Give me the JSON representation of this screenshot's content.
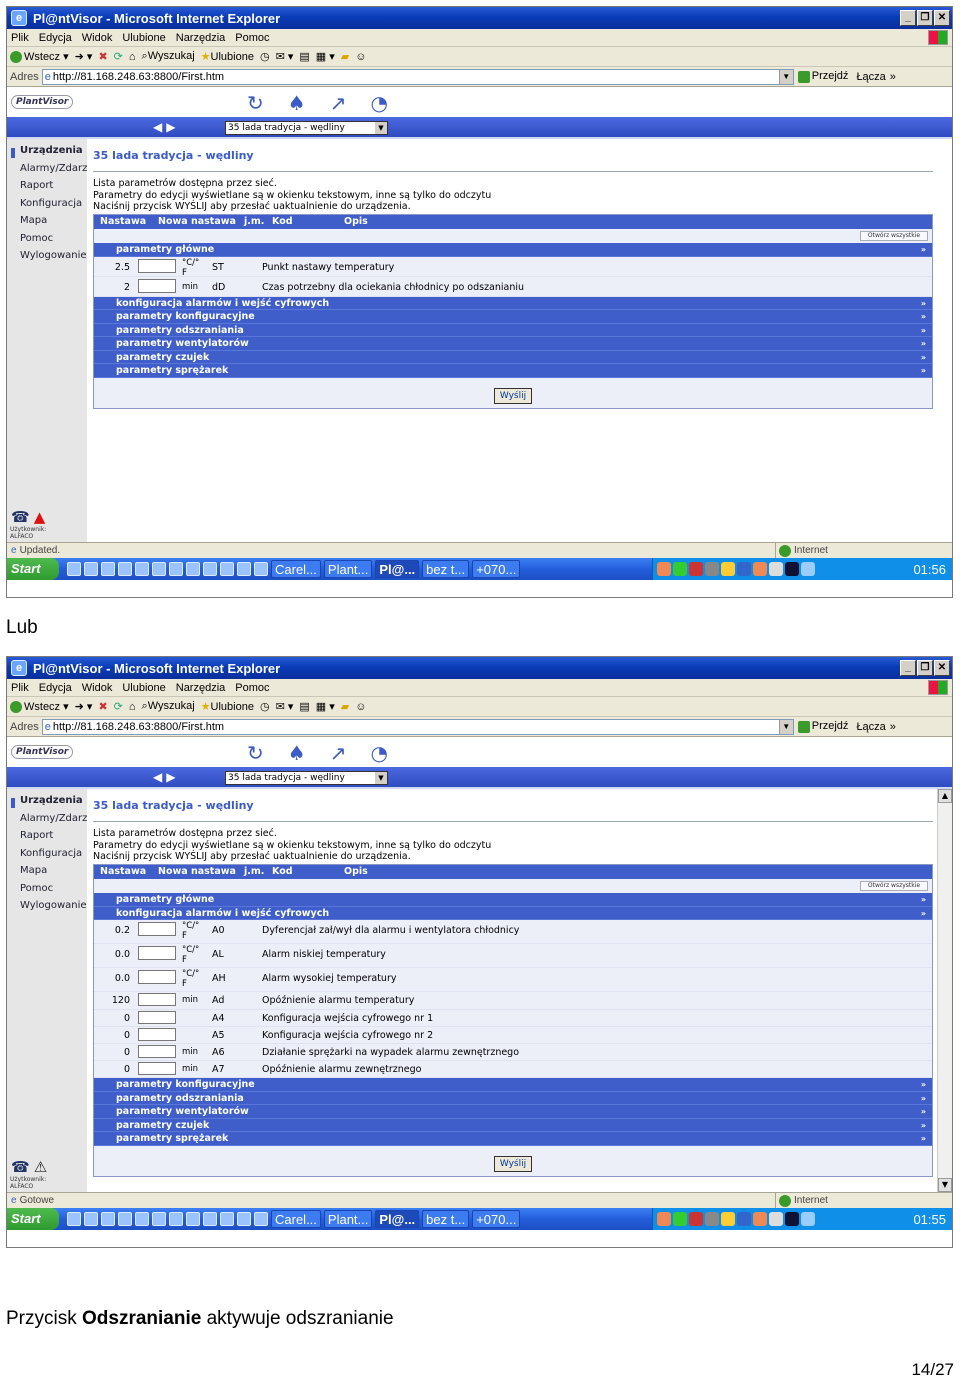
{
  "window_title": "Pl@ntVisor - Microsoft Internet Explorer",
  "menu": [
    "Plik",
    "Edycja",
    "Widok",
    "Ulubione",
    "Narzędzia",
    "Pomoc"
  ],
  "toolbar": {
    "back": "Wstecz",
    "search": "Wyszukaj",
    "favorites": "Ulubione"
  },
  "address": {
    "label": "Adres",
    "url": "http://81.168.248.63:8800/First.htm",
    "go": "Przejdź",
    "links": "Łącza"
  },
  "app": {
    "logo": "PlantVisor",
    "device_select": "35 lada tradycja - wędliny"
  },
  "sidebar": {
    "items": [
      "Urządzenia",
      "Alarmy/Zdarzenia",
      "Raport",
      "Konfiguracja",
      "Mapa",
      "Pomoc",
      "Wylogowanie"
    ],
    "user": "Użytkownik: ALFACO"
  },
  "page": {
    "title": "35 lada tradycja - wędliny",
    "desc1": "Lista parametrów dostępna przez sieć.",
    "desc2": "Parametry do edycji wyświetlane są w okienku tekstowym, inne są tylko do odczytu",
    "desc3": "Naciśnij przycisk WYŚLIJ aby przesłać uaktualnienie do urządzenia."
  },
  "grid": {
    "col_value": "Nastawa",
    "col_new": "Nowa nastawa",
    "col_unit": "j.m.",
    "col_code": "Kod",
    "col_desc": "Opis",
    "open_all": "Otwórz wszystkie",
    "send": "Wyślij"
  },
  "sections": {
    "main": "parametry główne",
    "alarm": "konfiguracja alarmów i wejść cyfrowych",
    "config": "parametry konfiguracyjne",
    "defrost": "parametry odszraniania",
    "fans": "parametry wentylatorów",
    "probes": "parametry czujek",
    "comp": "parametry sprężarek"
  },
  "shot1": {
    "params": [
      {
        "val": "2.5",
        "unit": "°C/° F",
        "code": "ST",
        "desc": "Punkt nastawy temperatury"
      },
      {
        "val": "2",
        "unit": "min",
        "code": "dD",
        "desc": "Czas potrzebny dla ociekania chłodnicy po odszanianiu"
      }
    ],
    "status": "Updated.",
    "clock": "01:56"
  },
  "shot2": {
    "params": [
      {
        "val": "0.2",
        "unit": "°C/° F",
        "code": "A0",
        "desc": "Dyferencjał zał/wył dla alarmu i wentylatora chłodnicy"
      },
      {
        "val": "0.0",
        "unit": "°C/° F",
        "code": "AL",
        "desc": "Alarm niskiej temperatury"
      },
      {
        "val": "0.0",
        "unit": "°C/° F",
        "code": "AH",
        "desc": "Alarm wysokiej temperatury"
      },
      {
        "val": "120",
        "unit": "min",
        "code": "Ad",
        "desc": "Opóźnienie alarmu temperatury"
      },
      {
        "val": "0",
        "unit": "",
        "code": "A4",
        "desc": "Konfiguracja wejścia cyfrowego nr 1"
      },
      {
        "val": "0",
        "unit": "",
        "code": "A5",
        "desc": "Konfiguracja wejścia cyfrowego nr 2"
      },
      {
        "val": "0",
        "unit": "min",
        "code": "A6",
        "desc": "Działanie sprężarki na wypadek alarmu zewnętrznego"
      },
      {
        "val": "0",
        "unit": "min",
        "code": "A7",
        "desc": "Opóźnienie alarmu zewnętrznego"
      }
    ],
    "status": "Gotowe",
    "clock": "01:55"
  },
  "status_zone": "Internet",
  "taskbar": {
    "start": "Start",
    "tasks": [
      "Carel...",
      "Plant...",
      "Pl@...",
      "bez t...",
      "+070..."
    ]
  },
  "doc": {
    "lub": "Lub",
    "caption_pre": "Przycisk ",
    "caption_bold": "Odszranianie",
    "caption_post": " aktywuje odszranianie",
    "page": "14/27"
  }
}
